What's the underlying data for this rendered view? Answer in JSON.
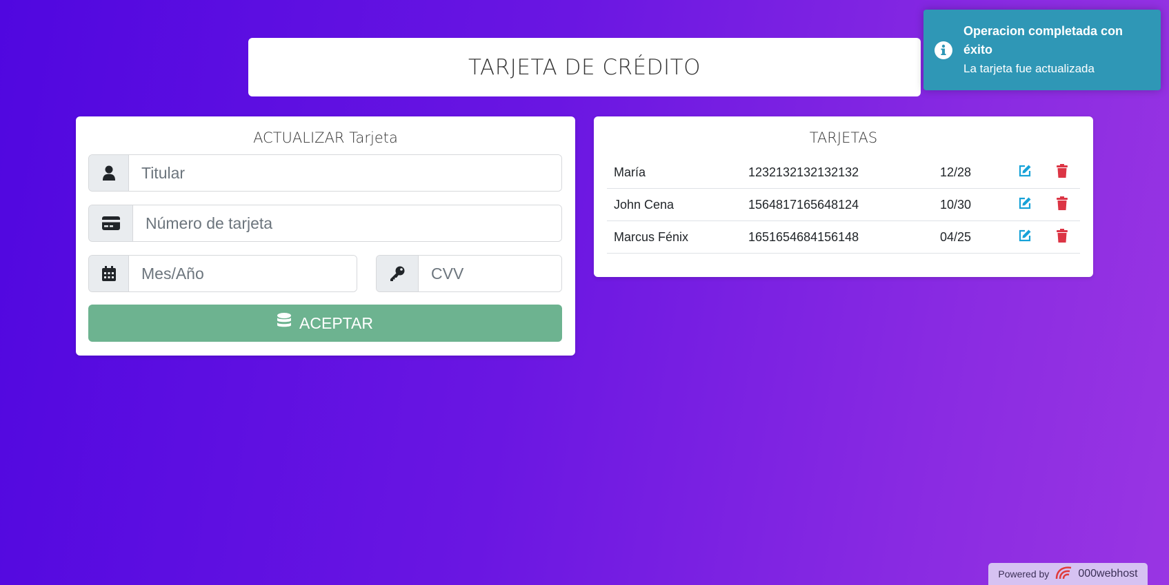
{
  "header": {
    "title": "TARJETA DE CRÉDITO"
  },
  "form": {
    "title": "ACTUALIZAR Tarjeta",
    "holder_placeholder": "Titular",
    "number_placeholder": "Número de tarjeta",
    "expiry_placeholder": "Mes/Año",
    "cvv_placeholder": "CVV",
    "submit_label": "ACEPTAR",
    "submit_color": "#6db390"
  },
  "list": {
    "title": "TARJETAS",
    "rows": [
      {
        "name": "María",
        "number": "1232132132132132",
        "expiry": "12/28"
      },
      {
        "name": "John Cena",
        "number": "1564817165648124",
        "expiry": "10/30"
      },
      {
        "name": "Marcus Fénix",
        "number": "1651654684156148",
        "expiry": "04/25"
      }
    ],
    "edit_icon": "edit-icon",
    "delete_icon": "trash-icon",
    "edit_color": "#17a2d8",
    "delete_color": "#dc3545"
  },
  "toast": {
    "title": "Operacion completada con éxito",
    "message": "La tarjeta fue actualizada",
    "icon": "info-icon",
    "color": "#2f97b6"
  },
  "footer": {
    "powered_by": "Powered by",
    "brand": "000webhost"
  },
  "theme": {
    "gradient_start": "#5007e0",
    "gradient_end": "#9935e3"
  }
}
